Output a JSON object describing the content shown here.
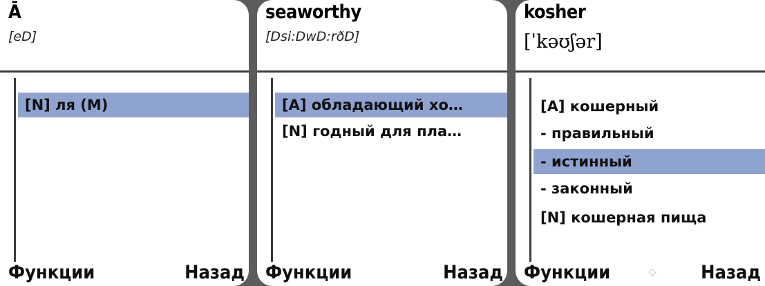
{
  "screens": [
    {
      "headword": "Ā",
      "transcription": "[eD]",
      "entries": [
        {
          "text": "[N] ля  (M)",
          "selected": true
        }
      ],
      "softkeys": {
        "left": "Функции",
        "right": "Назад"
      }
    },
    {
      "headword": "seaworthy",
      "transcription": "[Dsi:DwD:rðD]",
      "entries": [
        {
          "text": "[A] обладающий хо…",
          "selected": true
        },
        {
          "text": "[N] годный для пла…",
          "selected": false
        }
      ],
      "softkeys": {
        "left": "Функции",
        "right": "Назад"
      }
    },
    {
      "headword": "kosher",
      "transcription": "[ˈkəʊʃər]",
      "entries": [
        {
          "text": "[A] кошерный",
          "selected": false
        },
        {
          "text": "- правильный",
          "selected": false
        },
        {
          "text": "- истинный",
          "selected": true
        },
        {
          "text": "- законный",
          "selected": false
        },
        {
          "text": "[N] кошерная пища",
          "selected": false
        }
      ],
      "softkeys": {
        "left": "Функции",
        "right": "Назад"
      },
      "scroll_indicator_icon": "up-down-arrows-icon"
    }
  ],
  "colors": {
    "selection": "#8fa3d0",
    "background": "#5c5c5c"
  }
}
